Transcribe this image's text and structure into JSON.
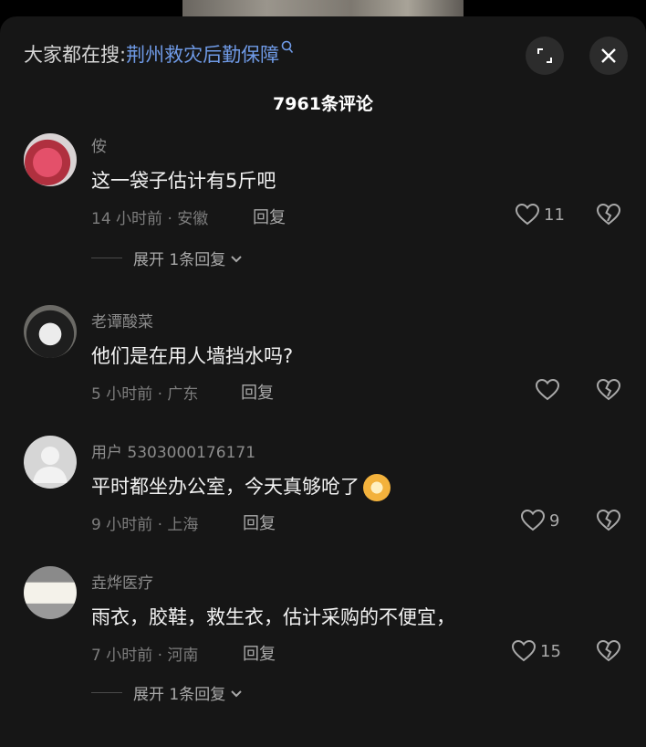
{
  "header": {
    "search_prefix": "大家都在搜:",
    "search_term": "荆州救灾后勤保障",
    "comment_count": "7961条评论"
  },
  "comments": [
    {
      "username": "侒",
      "text": "这一袋子估计有5斤吧",
      "meta": "14 小时前 · 安徽",
      "reply_label": "回复",
      "likes": "11",
      "expand_label": "展开 1条回复"
    },
    {
      "username": "老谭酸菜",
      "text": "他们是在用人墙挡水吗?",
      "meta": "5 小时前 · 广东",
      "reply_label": "回复",
      "likes": ""
    },
    {
      "username": "用户 5303000176171",
      "text": "平时都坐办公室，今天真够呛了",
      "meta": "9 小时前 · 上海",
      "reply_label": "回复",
      "likes": "9"
    },
    {
      "username": "垚烨医疗",
      "text": "雨衣，胶鞋，救生衣，估计采购的不便宜，",
      "meta": "7 小时前 · 河南",
      "reply_label": "回复",
      "likes": "15",
      "expand_label": "展开 1条回复"
    }
  ],
  "icons": {
    "search": "magnifier-icon",
    "expand": "expand-icon",
    "close": "close-icon",
    "like": "heart-icon",
    "dislike": "broken-heart-icon"
  }
}
